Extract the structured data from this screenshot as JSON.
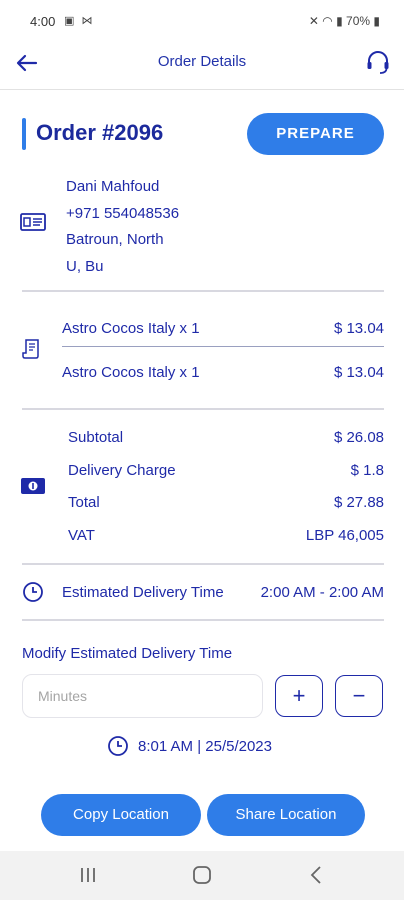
{
  "status_bar": {
    "time": "4:00",
    "left_icons": "▣ ⋈",
    "right_info": "70%"
  },
  "header": {
    "title": "Order Details",
    "back_icon": "arrow-left-icon",
    "support_icon": "headset-icon"
  },
  "order": {
    "title": "Order #2096",
    "prepare_label": "PREPARE",
    "accent_color": "#2f7de8"
  },
  "customer": {
    "name": "Dani Mahfoud",
    "phone": "+971 554048536",
    "address_line1": "Batroun, North",
    "address_line2": "U, Bu"
  },
  "items": [
    {
      "name": "Astro Cocos Italy x 1",
      "price": "$ 13.04"
    },
    {
      "name": "Astro Cocos Italy x 1",
      "price": "$ 13.04"
    }
  ],
  "totals": [
    {
      "label": "Subtotal",
      "value": "$ 26.08"
    },
    {
      "label": "Delivery Charge",
      "value": "$ 1.8"
    },
    {
      "label": "Total",
      "value": "$ 27.88"
    },
    {
      "label": "VAT",
      "value": "LBP 46,005"
    }
  ],
  "estimate": {
    "label": "Estimated Delivery Time",
    "value": "2:00 AM - 2:00 AM"
  },
  "modify": {
    "label": "Modify Estimated Delivery Time",
    "placeholder": "Minutes",
    "plus": "+",
    "minus": "−",
    "timestamp": "8:01 AM  | 25/5/2023"
  },
  "actions": {
    "copy_location": "Copy Location",
    "share_location": "Share Location"
  }
}
